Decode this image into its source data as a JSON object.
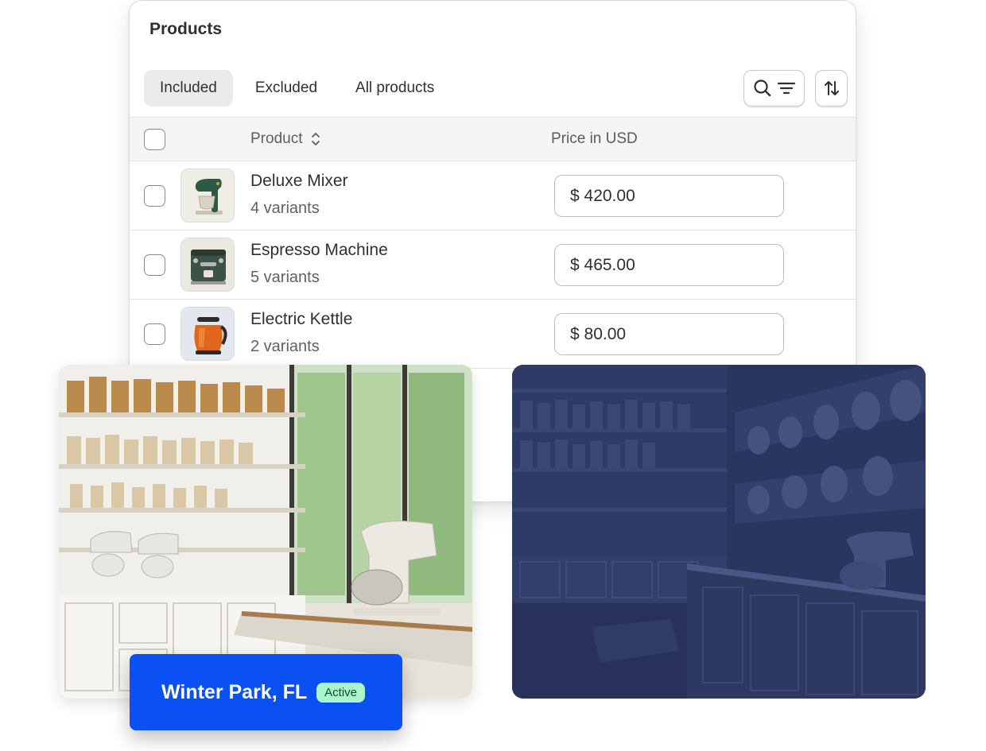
{
  "card": {
    "title": "Products",
    "tabs": [
      {
        "label": "Included",
        "active": true
      },
      {
        "label": "Excluded",
        "active": false
      },
      {
        "label": "All products",
        "active": false
      }
    ],
    "toolbar": {
      "search_filter_icons": [
        "search-icon",
        "filter-icon"
      ],
      "sort_icon": "sort-icon"
    },
    "columns": {
      "product": "Product",
      "price": "Price in USD"
    },
    "rows": [
      {
        "name": "Deluxe Mixer",
        "variants": "4 variants",
        "price": "$ 420.00",
        "thumb_icon": "stand-mixer"
      },
      {
        "name": "Espresso Machine",
        "variants": "5 variants",
        "price": "$ 465.00",
        "thumb_icon": "espresso-machine"
      },
      {
        "name": "Electric Kettle",
        "variants": "2 variants",
        "price": "$ 80.00",
        "thumb_icon": "electric-kettle"
      }
    ]
  },
  "locations": [
    {
      "name": "Winter Park, FL",
      "status": "Active",
      "photo": "bright-kitchen-store",
      "selected": true
    },
    {
      "name": "",
      "status": "",
      "photo": "dimmed-kitchen-store",
      "selected": false
    }
  ],
  "colors": {
    "badge_bg": "#0a50f2",
    "status_pill_bg": "#a9f5cc",
    "overlay": "#1a2450",
    "tab_active_bg": "#ebebeb"
  }
}
